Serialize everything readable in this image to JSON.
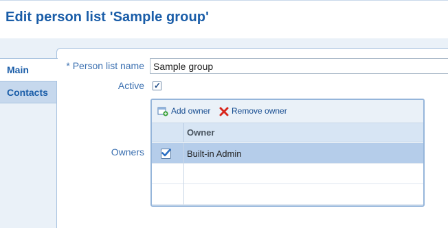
{
  "header": {
    "title": "Edit person list 'Sample group'"
  },
  "tabs": [
    {
      "label": "Main",
      "selected": true
    },
    {
      "label": "Contacts",
      "selected": false
    }
  ],
  "form": {
    "name_label": "Person list name",
    "name_required_marker": "* ",
    "name_value": "Sample group",
    "active_label": "Active",
    "active_checked": true,
    "owners_label": "Owners"
  },
  "owners_grid": {
    "toolbar": {
      "add_label": "Add owner",
      "remove_label": "Remove owner"
    },
    "column_header": "Owner",
    "rows": [
      {
        "owner": "Built-in Admin",
        "checked": true
      },
      {
        "owner": "",
        "checked": false
      },
      {
        "owner": "",
        "checked": false
      }
    ]
  },
  "colors": {
    "title_blue": "#1a5da8",
    "label_blue": "#3a6fb0",
    "band_bg": "#eaf1f8",
    "selected_row": "#b5cdea"
  }
}
